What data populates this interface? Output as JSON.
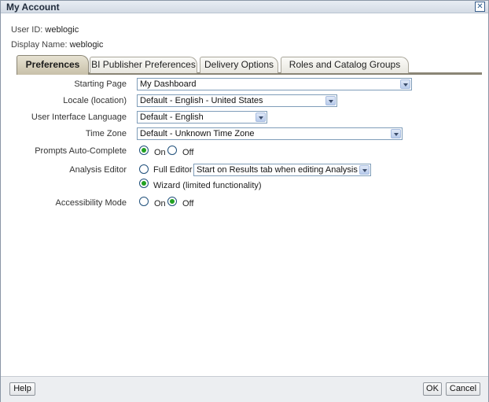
{
  "window": {
    "title": "My Account",
    "close_glyph": "✕"
  },
  "account": {
    "user_id_label": "User ID:",
    "user_id": "weblogic",
    "display_name_label": "Display Name:",
    "display_name": "weblogic"
  },
  "tabs": [
    {
      "label": "Preferences",
      "active": true
    },
    {
      "label": "BI Publisher Preferences",
      "active": false
    },
    {
      "label": "Delivery Options",
      "active": false
    },
    {
      "label": "Roles and Catalog Groups",
      "active": false
    }
  ],
  "preferences": {
    "starting_page": {
      "label": "Starting Page",
      "value": "My Dashboard"
    },
    "locale": {
      "label": "Locale (location)",
      "value": "Default - English - United States"
    },
    "ui_language": {
      "label": "User Interface Language",
      "value": "Default - English"
    },
    "time_zone": {
      "label": "Time Zone",
      "value": "Default - Unknown Time Zone"
    },
    "prompts_auto_complete": {
      "label": "Prompts Auto-Complete",
      "on_label": "On",
      "off_label": "Off",
      "selected": "On"
    },
    "analysis_editor": {
      "label": "Analysis Editor",
      "full_editor_label": "Full Editor",
      "full_editor_option": "Start on Results tab when editing Analysis",
      "wizard_label": "Wizard (limited functionality)",
      "selected": "Wizard"
    },
    "accessibility_mode": {
      "label": "Accessibility Mode",
      "on_label": "On",
      "off_label": "Off",
      "selected": "Off"
    }
  },
  "footer": {
    "help_label": "Help",
    "ok_label": "OK",
    "cancel_label": "Cancel"
  },
  "colors": {
    "radio_selected": "#21a121",
    "active_tab": "#c8c0a9"
  }
}
